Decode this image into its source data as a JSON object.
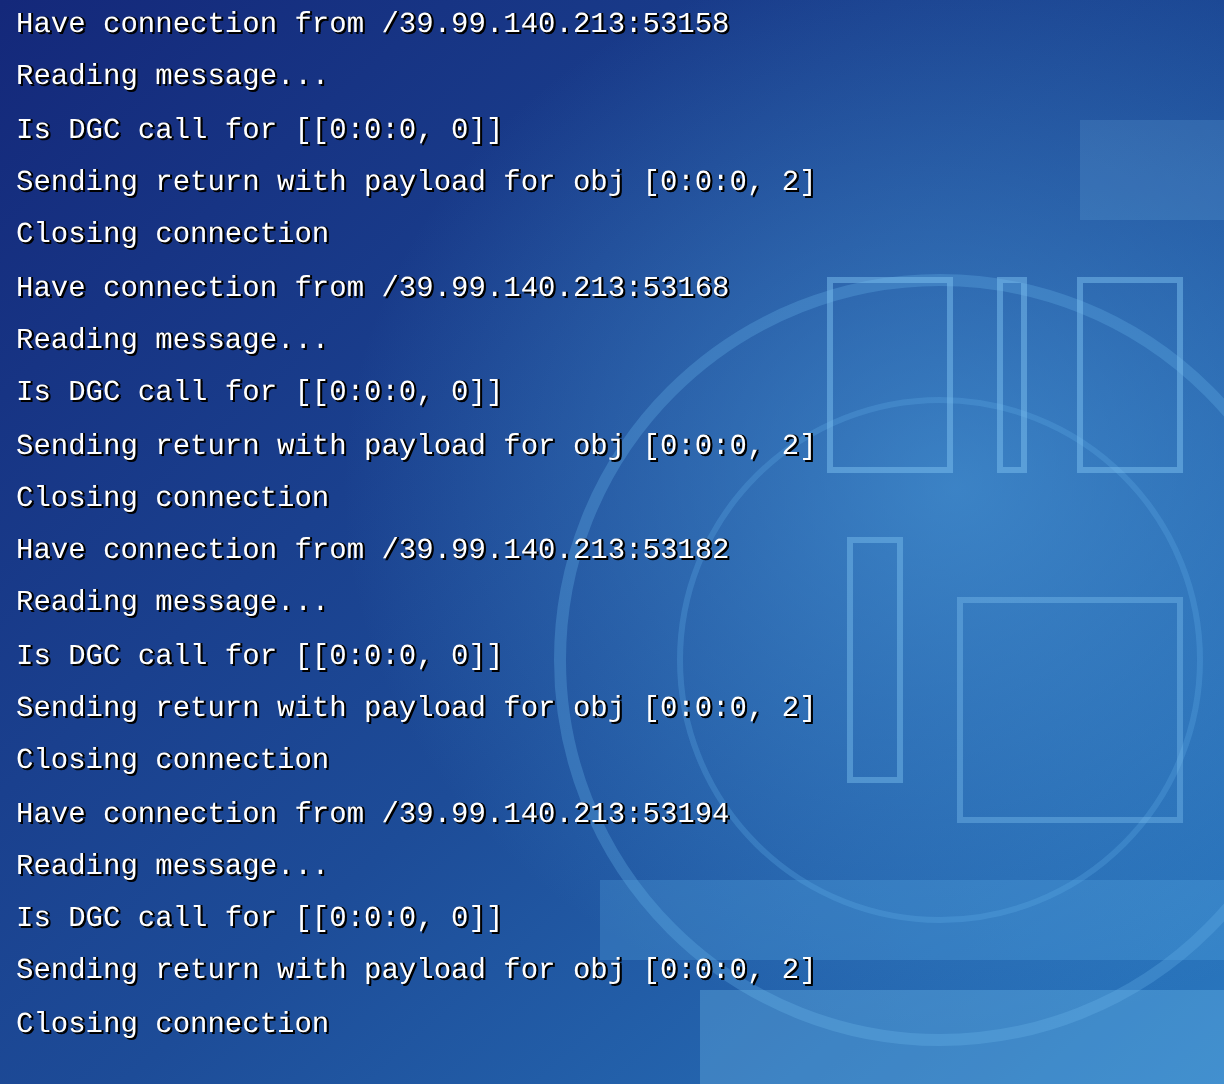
{
  "lines": [
    "Have connection from /39.99.140.213:53158",
    "Reading message...",
    "Is DGC call for [[0:0:0, 0]]",
    "Sending return with payload for obj [0:0:0, 2]",
    "Closing connection",
    "Have connection from /39.99.140.213:53168",
    "Reading message...",
    "Is DGC call for [[0:0:0, 0]]",
    "Sending return with payload for obj [0:0:0, 2]",
    "Closing connection",
    "Have connection from /39.99.140.213:53182",
    "Reading message...",
    "Is DGC call for [[0:0:0, 0]]",
    "Sending return with payload for obj [0:0:0, 2]",
    "Closing connection",
    "Have connection from /39.99.140.213:53194",
    "Reading message...",
    "Is DGC call for [[0:0:0, 0]]",
    "Sending return with payload for obj [0:0:0, 2]",
    "Closing connection"
  ]
}
